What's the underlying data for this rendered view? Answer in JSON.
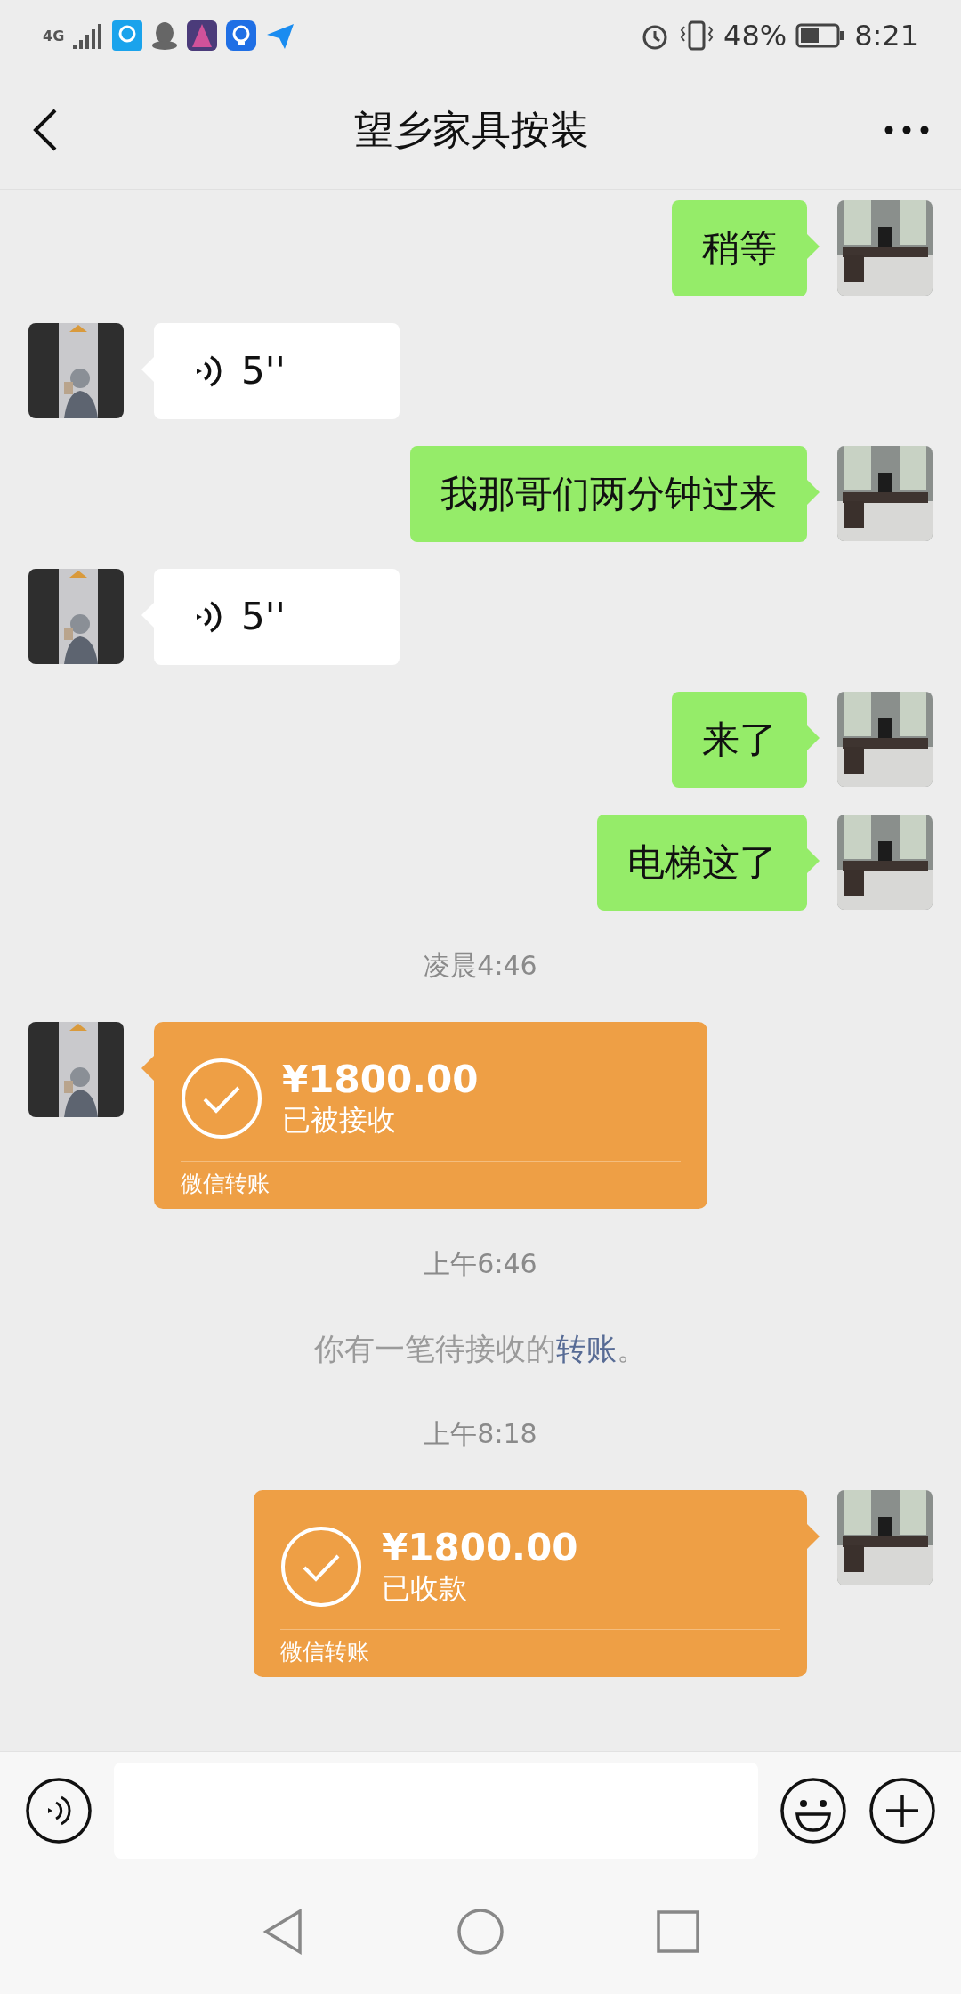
{
  "status_bar": {
    "network": "4G",
    "battery": "48%",
    "time": "8:21"
  },
  "header": {
    "title": "望乡家具按装"
  },
  "messages": [
    {
      "kind": "text",
      "outgoing": true,
      "text": "稍等"
    },
    {
      "kind": "voice",
      "outgoing": false,
      "duration": "5''"
    },
    {
      "kind": "text",
      "outgoing": true,
      "text": "我那哥们两分钟过来"
    },
    {
      "kind": "voice",
      "outgoing": false,
      "duration": "5''"
    },
    {
      "kind": "text",
      "outgoing": true,
      "text": "来了"
    },
    {
      "kind": "text",
      "outgoing": true,
      "text": "电梯这了"
    },
    {
      "kind": "time",
      "text": "凌晨4:46"
    },
    {
      "kind": "transfer",
      "outgoing": false,
      "amount": "¥1800.00",
      "status": "已被接收",
      "footer": "微信转账"
    },
    {
      "kind": "time",
      "text": "上午6:46"
    },
    {
      "kind": "system",
      "before": "你有一笔待接收的",
      "link": "转账",
      "after": "。"
    },
    {
      "kind": "time",
      "text": "上午8:18"
    },
    {
      "kind": "transfer",
      "outgoing": true,
      "amount": "¥1800.00",
      "status": "已收款",
      "footer": "微信转账"
    }
  ]
}
